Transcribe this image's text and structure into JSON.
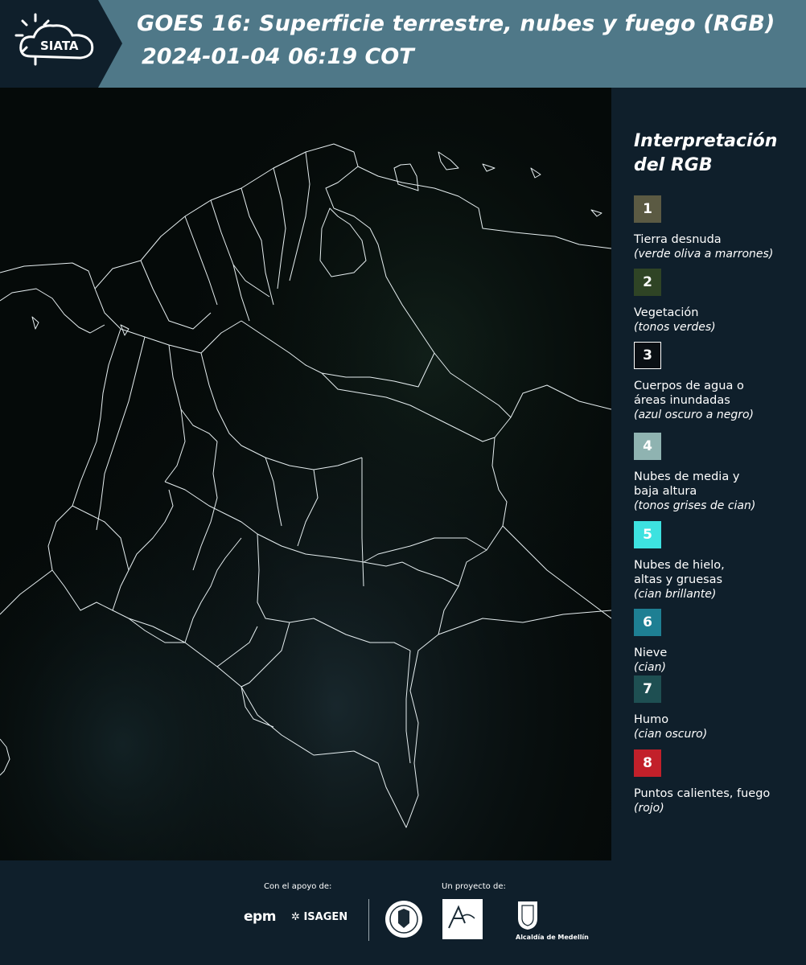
{
  "header": {
    "logo_text": "SIATA",
    "title_line1": "GOES 16: Superficie terrestre, nubes y fuego (RGB)",
    "title_line2": "2024-01-04 06:19 COT"
  },
  "legend": {
    "title_line1": "Interpretación",
    "title_line2": "del RGB",
    "items": [
      {
        "number": "1",
        "color": "#5b5a43",
        "label_lines": [
          "Tierra desnuda"
        ],
        "note": "(verde oliva a marrones)"
      },
      {
        "number": "2",
        "color": "#2f4425",
        "label_lines": [
          "Vegetación"
        ],
        "note": "(tonos verdes)"
      },
      {
        "number": "3",
        "color": "#0a0f14",
        "label_lines": [
          "Cuerpos de agua o",
          "áreas inundadas"
        ],
        "note": "(azul oscuro a negro)"
      },
      {
        "number": "4",
        "color": "#8fb3b1",
        "label_lines": [
          "Nubes de media y",
          "baja altura"
        ],
        "note": "(tonos grises de cian)"
      },
      {
        "number": "5",
        "color": "#3de2e0",
        "label_lines": [
          "Nubes de hielo,",
          "altas y gruesas"
        ],
        "note": "(cian brillante)"
      },
      {
        "number": "6",
        "color": "#1e7f93",
        "label_lines": [
          "Nieve"
        ],
        "note": "(cian)"
      },
      {
        "number": "7",
        "color": "#1e4f52",
        "label_lines": [
          "Humo"
        ],
        "note": "(cian oscuro)"
      },
      {
        "number": "8",
        "color": "#c2202a",
        "label_lines": [
          "Puntos calientes, fuego"
        ],
        "note": "(rojo)"
      }
    ]
  },
  "footer": {
    "support_caption": "Con el apoyo de:",
    "project_caption": "Un proyecto de:",
    "sponsors": [
      "epm",
      "ISAGEN"
    ],
    "alcaldia": "Alcaldía de Medellín"
  }
}
